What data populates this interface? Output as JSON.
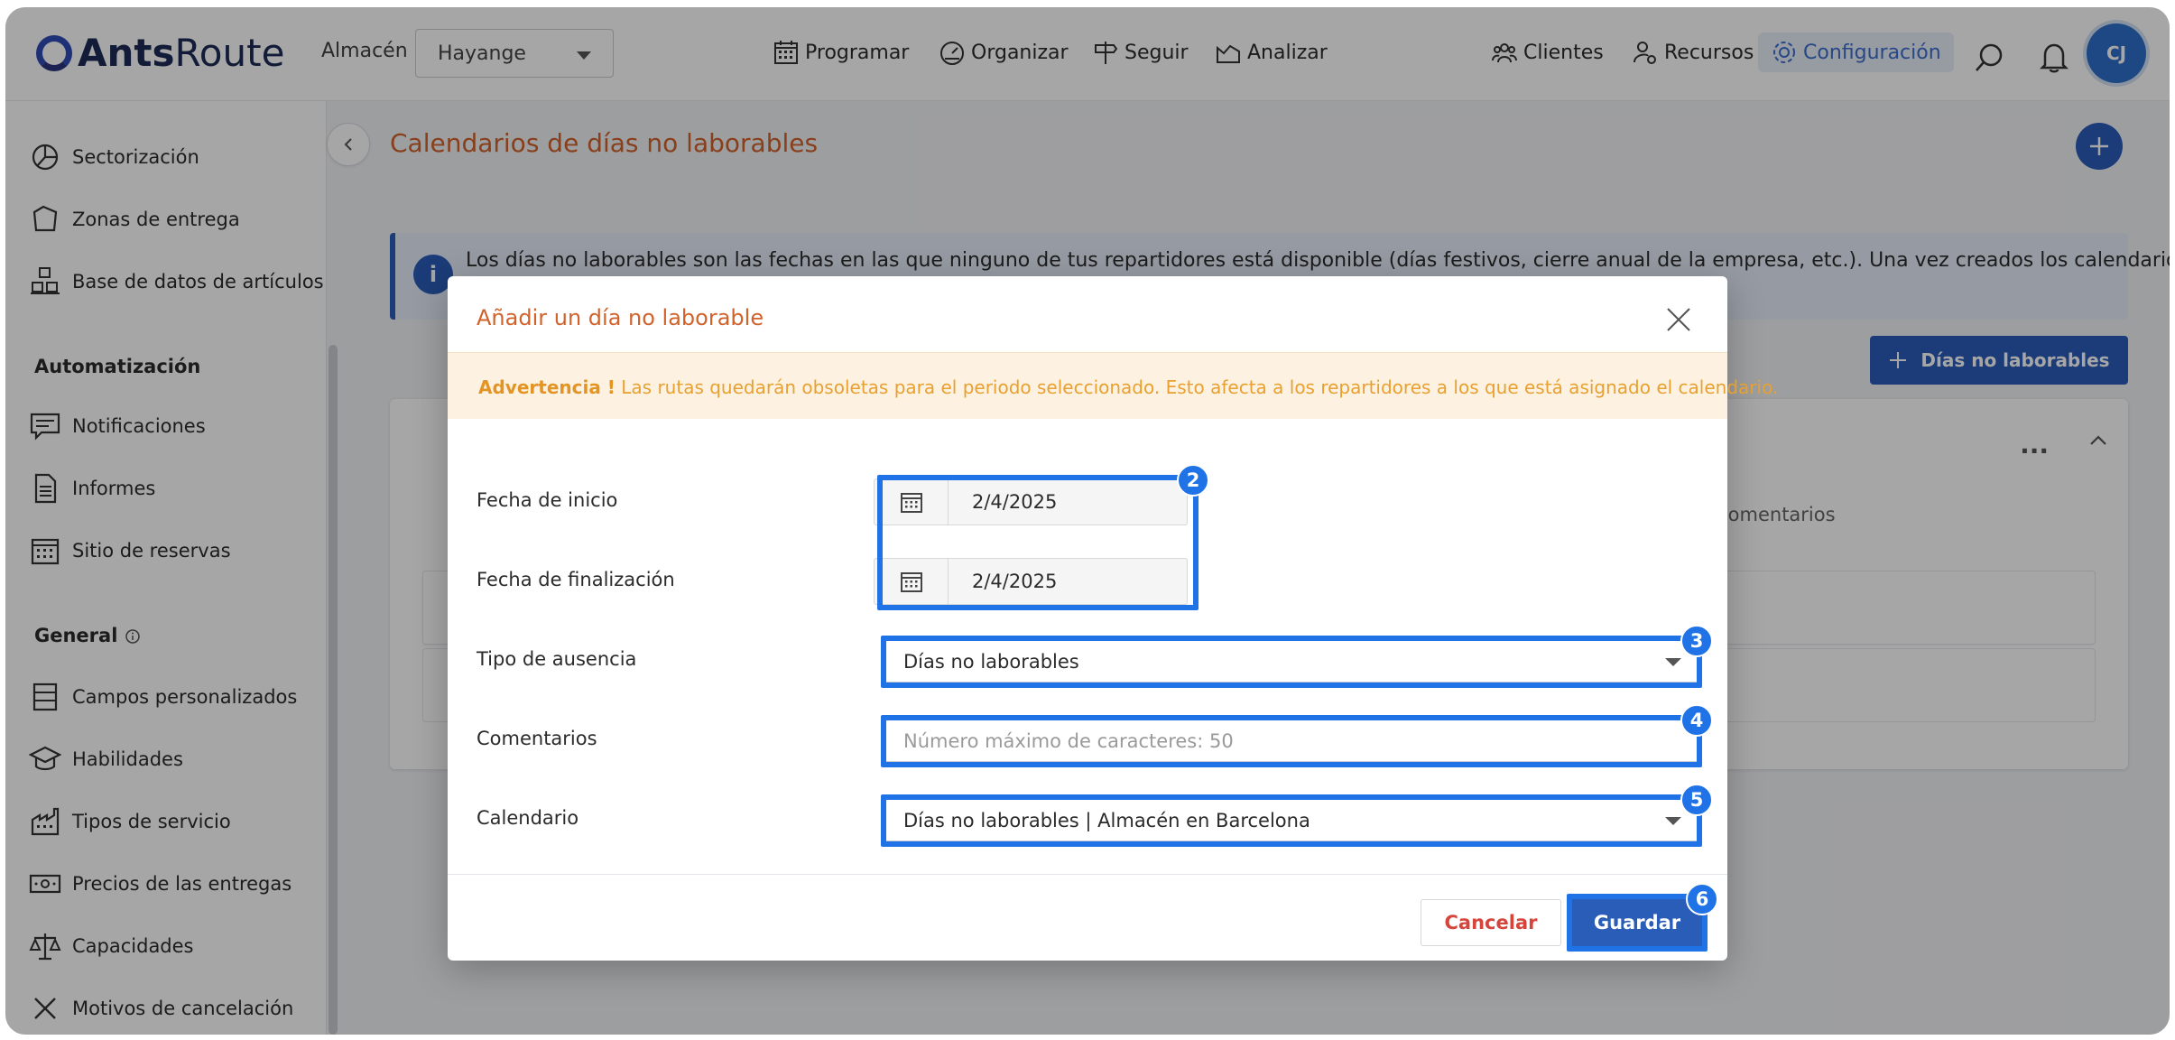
{
  "brand": {
    "name_bold": "Ants",
    "name_light": "Route",
    "color": "#2f4bb5"
  },
  "header": {
    "warehouse_label": "Almacén",
    "warehouse_value": "Hayange",
    "nav": {
      "schedule": "Programar",
      "organize": "Organizar",
      "track": "Seguir",
      "analyze": "Analizar",
      "clients": "Clientes",
      "resources": "Recursos",
      "settings": "Configuración"
    },
    "avatar_initials": "CJ"
  },
  "sidebar": {
    "items_top": [
      {
        "label": "Sectorización",
        "icon": "pie-chart-icon"
      },
      {
        "label": "Zonas de entrega",
        "icon": "polygon-icon"
      },
      {
        "label": "Base de datos de artículos",
        "icon": "boxes-icon"
      }
    ],
    "automation_title": "Automatización",
    "items_automation": [
      {
        "label": "Notificaciones",
        "icon": "message-icon"
      },
      {
        "label": "Informes",
        "icon": "document-icon"
      },
      {
        "label": "Sitio de reservas",
        "icon": "calendar-icon"
      }
    ],
    "general_title": "General",
    "items_general": [
      {
        "label": "Campos personalizados",
        "icon": "form-fields-icon"
      },
      {
        "label": "Habilidades",
        "icon": "graduation-cap-icon"
      },
      {
        "label": "Tipos de servicio",
        "icon": "factory-icon"
      },
      {
        "label": "Precios de las entregas",
        "icon": "banknote-icon"
      },
      {
        "label": "Capacidades",
        "icon": "scale-icon"
      },
      {
        "label": "Motivos de cancelación",
        "icon": "cross-icon"
      }
    ]
  },
  "page": {
    "title": "Calendarios de días no laborables",
    "info_text": "Los días no laborables son las fechas en las que ninguno de tus repartidores está disponible (días festivos, cierre anual de la empresa, etc.). Una vez creados los calendarios,",
    "days_button": "Días no laborables",
    "card_column": "Comentarios",
    "card_menu": "..."
  },
  "modal": {
    "title": "Añadir un día no laborable",
    "warning_strong": "Advertencia !",
    "warning_text": "Las rutas quedarán obsoletas para el periodo seleccionado. Esto afecta a los repartidores a los que está asignado el calendario.",
    "fields": {
      "start_label": "Fecha de inicio",
      "start_value": "2/4/2025",
      "end_label": "Fecha de finalización",
      "end_value": "2/4/2025",
      "type_label": "Tipo de ausencia",
      "type_value": "Días no laborables",
      "comments_label": "Comentarios",
      "comments_placeholder": "Número máximo de caracteres: 50",
      "calendar_label": "Calendario",
      "calendar_value": "Días no laborables | Almacén en Barcelona"
    },
    "cancel": "Cancelar",
    "save": "Guardar"
  },
  "steps": {
    "dates": "2",
    "type": "3",
    "comments": "4",
    "calendar": "5",
    "save": "6"
  },
  "colors": {
    "accent": "#2a5db8",
    "title_orange": "#d2622b",
    "warning": "#e8a030",
    "highlight": "#1f73e6"
  }
}
